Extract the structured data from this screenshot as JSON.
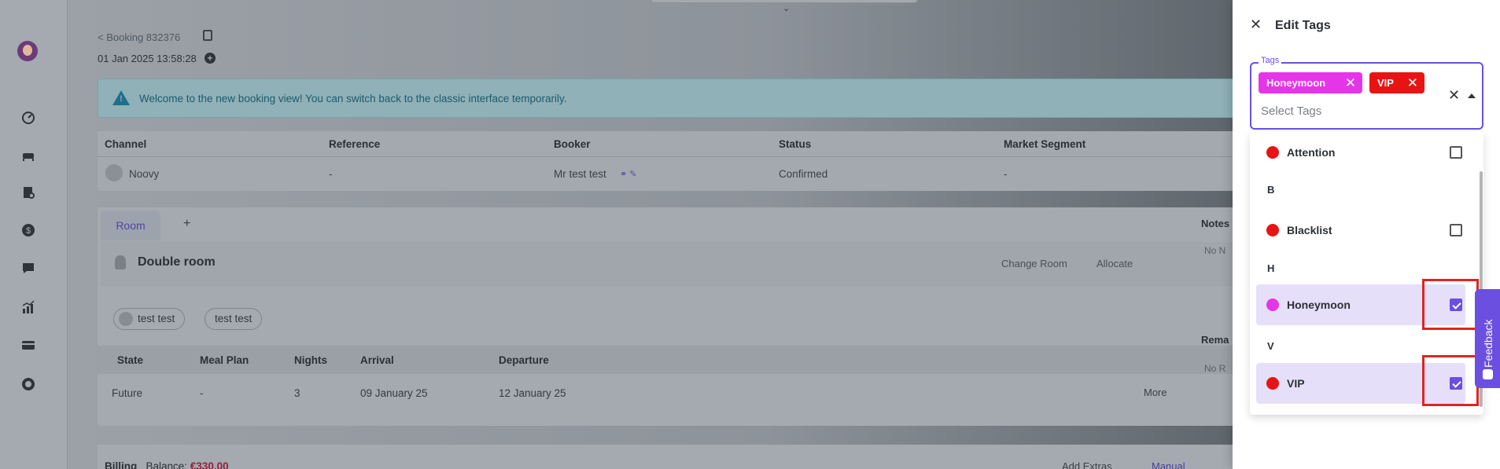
{
  "page": {
    "breadcrumb": "< Booking 832376",
    "timestamp": "01 Jan 2025 13:58:28",
    "banner": "Welcome to the new booking view! You can switch back to the classic interface temporarily."
  },
  "booking_table": {
    "headers": [
      "Channel",
      "Reference",
      "Booker",
      "Status",
      "Market Segment"
    ],
    "values": [
      "Noovy",
      "-",
      "Mr test test",
      "Confirmed",
      "-"
    ]
  },
  "room": {
    "tab_label": "Room",
    "tab_add": "+",
    "title": "Double room",
    "change_room": "Change Room",
    "allocate": "Allocate",
    "guests": [
      "test test",
      "test test"
    ],
    "stay_headers": [
      "State",
      "Meal Plan",
      "Nights",
      "Arrival",
      "Departure"
    ],
    "stay_values": [
      "Future",
      "-",
      "3",
      "09 January 25",
      "12 January 25"
    ],
    "more": "More"
  },
  "billing": {
    "label": "Billing",
    "balance_label": "Balance:",
    "balance_value": "€330.00",
    "add_extras": "Add Extras",
    "manual": "Manual"
  },
  "side_panel": {
    "notes": "Notes",
    "notes_empty": "No N",
    "remarks": "Rema",
    "remarks_empty": "No R"
  },
  "drawer": {
    "title": "Edit Tags",
    "field_label": "Tags",
    "placeholder": "Select Tags",
    "selected_chips": [
      {
        "label": "Honeymoon",
        "color": "#e535e8"
      },
      {
        "label": "VIP",
        "color": "#e81414"
      }
    ],
    "options": [
      {
        "group": "",
        "label": "Attention",
        "color": "#e81414",
        "checked": false
      },
      {
        "group": "B",
        "label": "Blacklist",
        "color": "#e81414",
        "checked": false
      },
      {
        "group": "H",
        "label": "Honeymoon",
        "color": "#e535e8",
        "checked": true
      },
      {
        "group": "V",
        "label": "VIP",
        "color": "#e81414",
        "checked": true
      }
    ]
  },
  "feedback": {
    "label": "Feedback"
  },
  "colors": {
    "accent": "#6b4fe0",
    "highlight": "#e02424"
  }
}
